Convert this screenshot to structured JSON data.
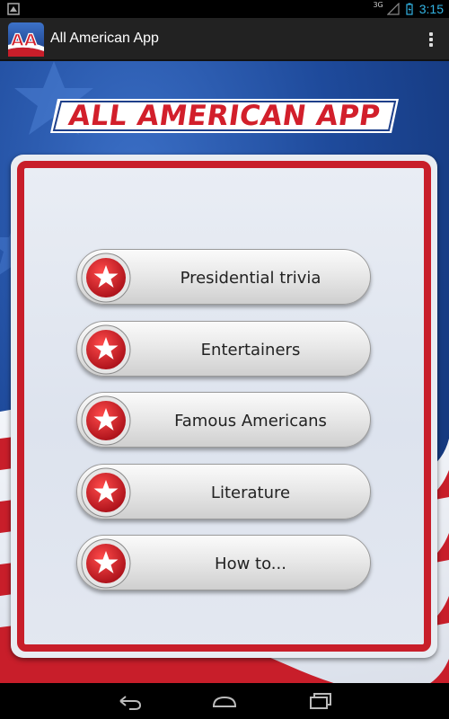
{
  "status_bar": {
    "network_type": "3G",
    "time": "3:15"
  },
  "action_bar": {
    "app_icon_text": "AA",
    "title": "All American App",
    "overflow_icon": "overflow-menu-icon"
  },
  "banner": {
    "logo_text": "ALL AMERICAN APP"
  },
  "menu": {
    "items": [
      {
        "label": "Presidential trivia",
        "icon": "star-icon"
      },
      {
        "label": "Entertainers",
        "icon": "star-icon"
      },
      {
        "label": "Famous Americans",
        "icon": "star-icon"
      },
      {
        "label": "Literature",
        "icon": "star-icon"
      },
      {
        "label": "How to...",
        "icon": "star-icon"
      }
    ]
  },
  "nav_bar": {
    "back_icon": "back-icon",
    "home_icon": "home-icon",
    "recents_icon": "recent-apps-icon"
  },
  "colors": {
    "accent_blue": "#33b5e5",
    "flag_red": "#c81e2a",
    "flag_blue": "#1e4a9b",
    "panel_fill": "#e8ecf2"
  }
}
